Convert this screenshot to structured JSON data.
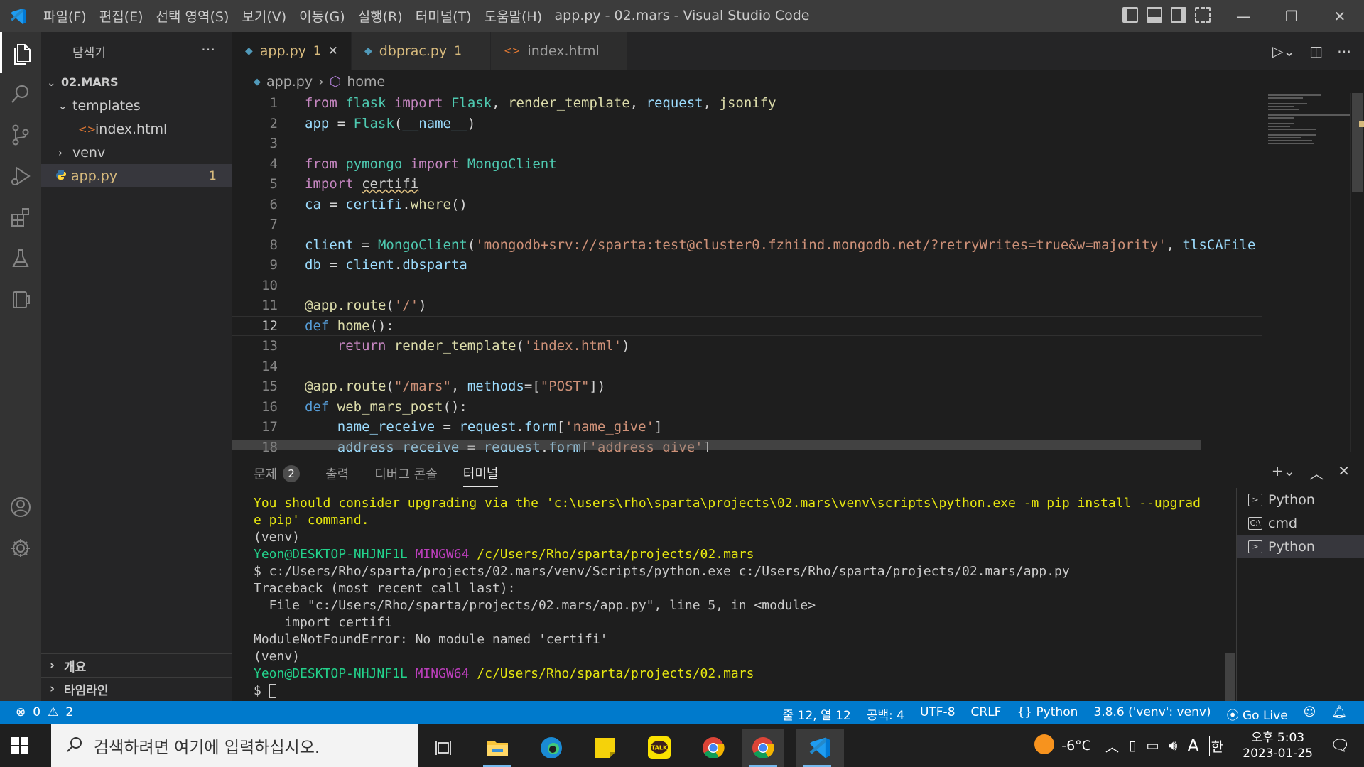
{
  "titlebar": {
    "menus": [
      "파일(F)",
      "편집(E)",
      "선택 영역(S)",
      "보기(V)",
      "이동(G)",
      "실행(R)",
      "터미널(T)",
      "도움말(H)"
    ],
    "window_title": "app.py - 02.mars - Visual Studio Code"
  },
  "sidebar": {
    "title": "탐색기",
    "root": "02.MARS",
    "items": [
      {
        "label": "templates"
      },
      {
        "label": "index.html"
      },
      {
        "label": "venv"
      },
      {
        "label": "app.py",
        "badge": "1"
      }
    ],
    "outline": "개요",
    "timeline": "타임라인"
  },
  "tabs": [
    {
      "label": "app.py",
      "badge": "1"
    },
    {
      "label": "dbprac.py",
      "badge": "1"
    },
    {
      "label": "index.html"
    }
  ],
  "breadcrumb": {
    "file": "app.py",
    "symbol": "home"
  },
  "editor": {
    "current_line": 12,
    "lines": [
      {
        "n": "1",
        "parts": [
          [
            "kw2",
            "from"
          ],
          [
            "pl",
            " "
          ],
          [
            "cls",
            "flask"
          ],
          [
            "pl",
            " "
          ],
          [
            "kw2",
            "import"
          ],
          [
            "pl",
            " "
          ],
          [
            "cls",
            "Flask"
          ],
          [
            "pl",
            ", "
          ],
          [
            "fn",
            "render_template"
          ],
          [
            "pl",
            ", "
          ],
          [
            "var",
            "request"
          ],
          [
            "pl",
            ", "
          ],
          [
            "fn",
            "jsonify"
          ]
        ]
      },
      {
        "n": "2",
        "parts": [
          [
            "var",
            "app"
          ],
          [
            "pl",
            " = "
          ],
          [
            "cls",
            "Flask"
          ],
          [
            "pl",
            "("
          ],
          [
            "var",
            "__name__"
          ],
          [
            "pl",
            ")"
          ]
        ]
      },
      {
        "n": "3",
        "parts": []
      },
      {
        "n": "4",
        "parts": [
          [
            "kw2",
            "from"
          ],
          [
            "pl",
            " "
          ],
          [
            "cls",
            "pymongo"
          ],
          [
            "pl",
            " "
          ],
          [
            "kw2",
            "import"
          ],
          [
            "pl",
            " "
          ],
          [
            "cls",
            "MongoClient"
          ]
        ]
      },
      {
        "n": "5",
        "parts": [
          [
            "kw2",
            "import"
          ],
          [
            "pl",
            " "
          ],
          [
            "squig",
            "certifi"
          ]
        ]
      },
      {
        "n": "6",
        "parts": [
          [
            "var",
            "ca"
          ],
          [
            "pl",
            " = "
          ],
          [
            "var",
            "certifi"
          ],
          [
            "pl",
            "."
          ],
          [
            "fn",
            "where"
          ],
          [
            "pl",
            "()"
          ]
        ]
      },
      {
        "n": "7",
        "parts": []
      },
      {
        "n": "8",
        "parts": [
          [
            "var",
            "client"
          ],
          [
            "pl",
            " = "
          ],
          [
            "cls",
            "MongoClient"
          ],
          [
            "pl",
            "("
          ],
          [
            "str",
            "'mongodb+srv://sparta:test@cluster0.fzhiind.mongodb.net/?retryWrites=true&w=majority'"
          ],
          [
            "pl",
            ", "
          ],
          [
            "var",
            "tlsCAFile"
          ]
        ]
      },
      {
        "n": "9",
        "parts": [
          [
            "var",
            "db"
          ],
          [
            "pl",
            " = "
          ],
          [
            "var",
            "client"
          ],
          [
            "pl",
            "."
          ],
          [
            "var",
            "dbsparta"
          ]
        ]
      },
      {
        "n": "10",
        "parts": []
      },
      {
        "n": "11",
        "parts": [
          [
            "fn",
            "@app.route"
          ],
          [
            "pl",
            "("
          ],
          [
            "str",
            "'/'"
          ],
          [
            "pl",
            ")"
          ]
        ]
      },
      {
        "n": "12",
        "parts": [
          [
            "kw",
            "def"
          ],
          [
            "pl",
            " "
          ],
          [
            "fn",
            "home"
          ],
          [
            "pl",
            "():"
          ]
        ]
      },
      {
        "n": "13",
        "parts": [
          [
            "pl",
            "    "
          ],
          [
            "kw2",
            "return"
          ],
          [
            "pl",
            " "
          ],
          [
            "fn",
            "render_template"
          ],
          [
            "pl",
            "("
          ],
          [
            "str",
            "'index.html'"
          ],
          [
            "pl",
            ")"
          ]
        ]
      },
      {
        "n": "14",
        "parts": []
      },
      {
        "n": "15",
        "parts": [
          [
            "fn",
            "@app.route"
          ],
          [
            "pl",
            "("
          ],
          [
            "str",
            "\"/mars\""
          ],
          [
            "pl",
            ", "
          ],
          [
            "var",
            "methods"
          ],
          [
            "pl",
            "=["
          ],
          [
            "str",
            "\"POST\""
          ],
          [
            "pl",
            "])"
          ]
        ]
      },
      {
        "n": "16",
        "parts": [
          [
            "kw",
            "def"
          ],
          [
            "pl",
            " "
          ],
          [
            "fn",
            "web_mars_post"
          ],
          [
            "pl",
            "():"
          ]
        ]
      },
      {
        "n": "17",
        "parts": [
          [
            "pl",
            "    "
          ],
          [
            "var",
            "name_receive"
          ],
          [
            "pl",
            " = "
          ],
          [
            "var",
            "request"
          ],
          [
            "pl",
            "."
          ],
          [
            "var",
            "form"
          ],
          [
            "pl",
            "["
          ],
          [
            "str",
            "'name_give'"
          ],
          [
            "pl",
            "]"
          ]
        ]
      },
      {
        "n": "18",
        "parts": [
          [
            "pl",
            "    "
          ],
          [
            "var",
            "address_receive"
          ],
          [
            "pl",
            " = "
          ],
          [
            "var",
            "request"
          ],
          [
            "pl",
            "."
          ],
          [
            "var",
            "form"
          ],
          [
            "pl",
            "["
          ],
          [
            "str",
            "'address_give'"
          ],
          [
            "pl",
            "]"
          ]
        ]
      }
    ]
  },
  "panel": {
    "tabs": [
      {
        "label": "문제",
        "count": "2"
      },
      {
        "label": "출력"
      },
      {
        "label": "디버그 콘솔"
      },
      {
        "label": "터미널"
      }
    ],
    "terminal_lines": [
      {
        "cls": "t-yellow",
        "text": "You should consider upgrading via the 'c:\\users\\rho\\sparta\\projects\\02.mars\\venv\\scripts\\python.exe -m pip install --upgrad"
      },
      {
        "cls": "t-yellow",
        "text": "e pip' command."
      },
      {
        "cls": "t-plain",
        "text": "(venv)"
      },
      {
        "cls": "prompt",
        "user": "Yeon@DESKTOP-NHJNF1L",
        "env": "MINGW64",
        "path": "/c/Users/Rho/sparta/projects/02.mars"
      },
      {
        "cls": "t-plain",
        "text": "$ c:/Users/Rho/sparta/projects/02.mars/venv/Scripts/python.exe c:/Users/Rho/sparta/projects/02.mars/app.py"
      },
      {
        "cls": "t-plain",
        "text": "Traceback (most recent call last):"
      },
      {
        "cls": "t-plain",
        "text": "  File \"c:/Users/Rho/sparta/projects/02.mars/app.py\", line 5, in <module>"
      },
      {
        "cls": "t-plain",
        "text": "    import certifi"
      },
      {
        "cls": "t-plain",
        "text": "ModuleNotFoundError: No module named 'certifi'"
      },
      {
        "cls": "t-plain",
        "text": "(venv)"
      },
      {
        "cls": "prompt",
        "user": "Yeon@DESKTOP-NHJNF1L",
        "env": "MINGW64",
        "path": "/c/Users/Rho/sparta/projects/02.mars"
      },
      {
        "cls": "cursor",
        "text": "$ "
      }
    ],
    "terminals": [
      {
        "label": "Python",
        "icon": "terminal-icon"
      },
      {
        "label": "cmd",
        "icon": "cmd-icon"
      },
      {
        "label": "Python",
        "icon": "terminal-icon",
        "selected": true
      }
    ]
  },
  "statusbar": {
    "errors": "0",
    "warnings": "2",
    "position": "줄 12, 열 12",
    "spaces": "공백: 4",
    "encoding": "UTF-8",
    "eol": "CRLF",
    "language": "Python",
    "interpreter": "3.8.6 ('venv': venv)",
    "golive": "Go Live"
  },
  "taskbar": {
    "search_placeholder": "검색하려면 여기에 입력하십시오.",
    "temperature": "-6°C",
    "ime_mode": "A",
    "ime_lang": "한",
    "time": "오후 5:03",
    "date": "2023-01-25"
  },
  "colors": {
    "statusbar": "#007acc",
    "activitybar": "#333333",
    "sidebar": "#252526",
    "editor": "#1e1e1e",
    "warning": "#d7ba7d"
  }
}
